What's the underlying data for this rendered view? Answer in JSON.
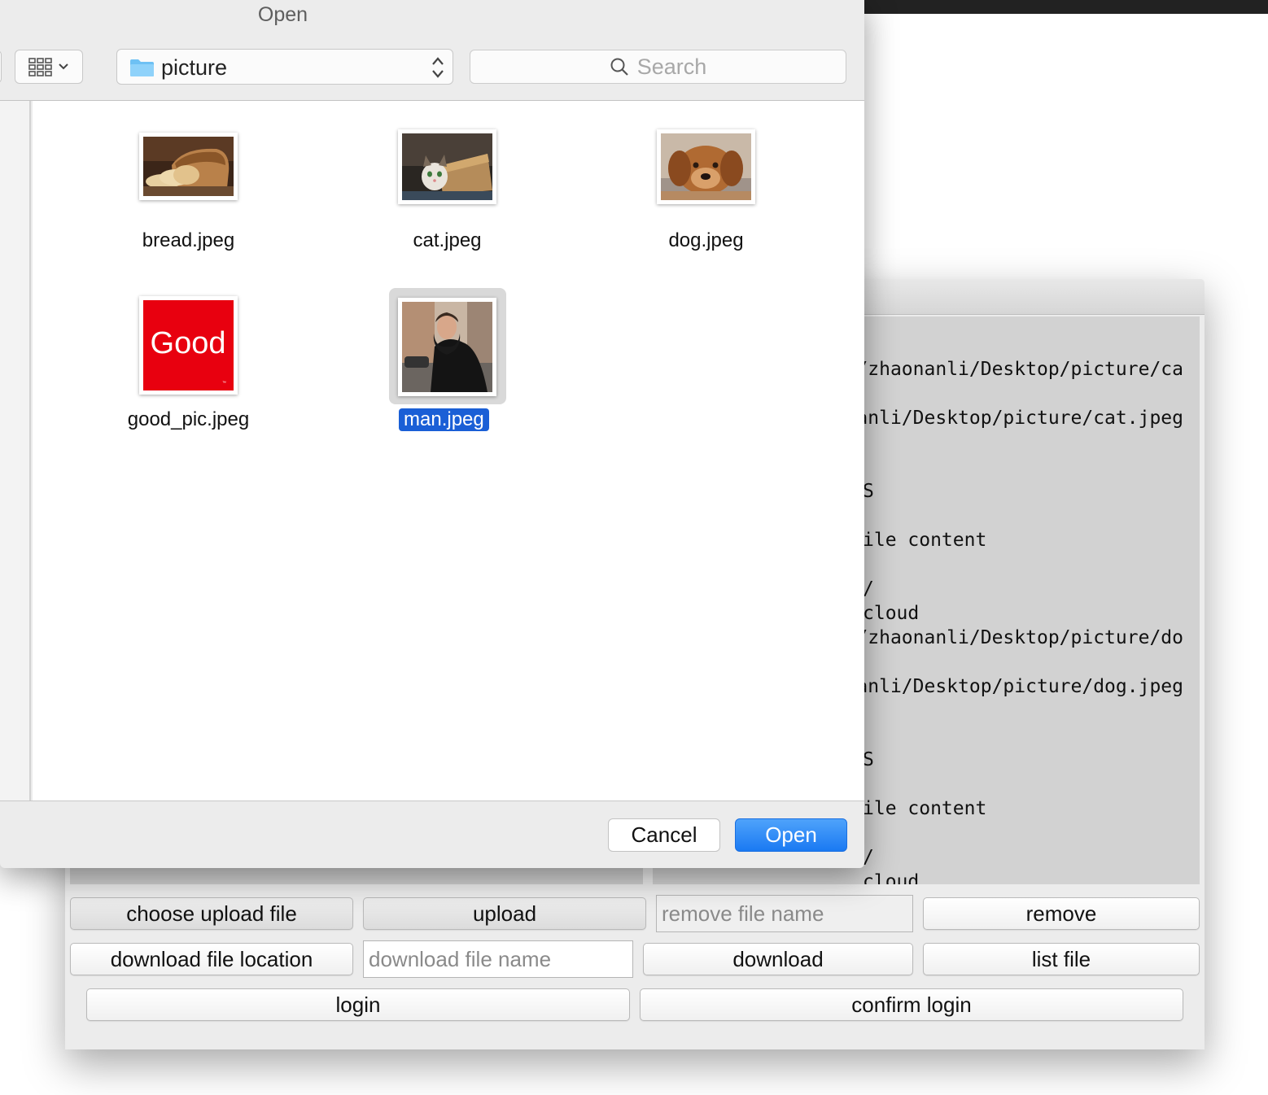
{
  "dialog": {
    "title": "Open",
    "location": "picture",
    "search_placeholder": "Search",
    "files": [
      {
        "name": "bread.jpeg",
        "thumbnail": "bread"
      },
      {
        "name": "cat.jpeg",
        "thumbnail": "cat"
      },
      {
        "name": "dog.jpeg",
        "thumbnail": "dog"
      },
      {
        "name": "good_pic.jpeg",
        "thumbnail": "red-good-logo",
        "thumb_text": "Good"
      },
      {
        "name": "man.jpeg",
        "thumbnail": "man",
        "selected": true
      }
    ],
    "cancel_label": "Cancel",
    "open_label": "Open",
    "icons": [
      "view-grid-icon",
      "chevron-down-icon",
      "folder-icon",
      "updown-icon",
      "search-icon"
    ]
  },
  "app": {
    "log_lines": [
      "/zhaonanli/Desktop/picture/ca",
      "anli/Desktop/picture/cat.jpeg",
      "S",
      "ile content",
      "/",
      "cloud",
      "/zhaonanli/Desktop/picture/do",
      "anli/Desktop/picture/dog.jpeg",
      "S",
      "ile content",
      "/",
      "cloud"
    ],
    "buttons": {
      "choose_upload_file": "choose upload file",
      "upload": "upload",
      "remove": "remove",
      "download_file_location": "download file location",
      "download": "download",
      "list_file": "list file",
      "login": "login",
      "confirm_login": "confirm login"
    },
    "inputs": {
      "remove_file_name_placeholder": "remove file name",
      "download_file_name_placeholder": "download file name"
    }
  },
  "colors": {
    "selection_blue": "#1a5fd6",
    "open_button": "#1a79f2",
    "good_red": "#e8000f"
  }
}
